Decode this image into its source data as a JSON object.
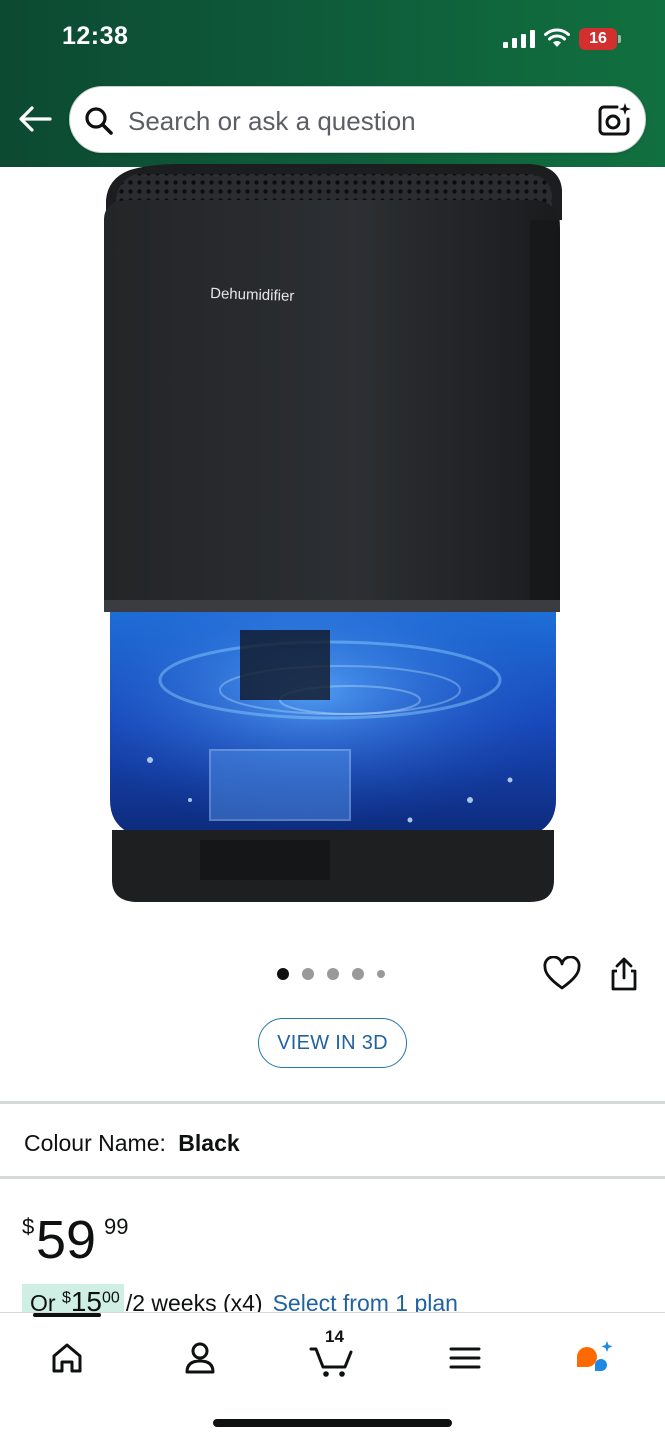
{
  "status_bar": {
    "time": "12:38",
    "battery_level": "16",
    "battery_color": "#d32f2f",
    "icons": [
      "cellular-signal-icon",
      "wifi-icon",
      "battery-icon"
    ]
  },
  "header": {
    "background_color": "#0e5a3a",
    "back_icon": "arrow-left-icon",
    "search": {
      "placeholder": "Search or ask a question",
      "value": "",
      "icon": "search-icon",
      "lens_icon": "camera-lens-icon"
    }
  },
  "product": {
    "image_label": "Dehumidifier",
    "image_count": 5,
    "active_image_index": 0,
    "wishlist_icon": "heart-icon",
    "share_icon": "share-icon",
    "view_3d_label": "VIEW IN 3D",
    "colour_label": "Colour Name:",
    "colour_value": "Black",
    "price": {
      "symbol": "$",
      "whole": "59",
      "fraction": "99"
    },
    "installment": {
      "prefix": "Or ",
      "symbol": "$",
      "whole": "15",
      "fraction": "00",
      "period": "/2 weeks (x4)",
      "link": "Select from 1 plan"
    }
  },
  "bottom_nav": {
    "items": [
      {
        "name": "home",
        "icon": "home-icon",
        "active": true
      },
      {
        "name": "account",
        "icon": "person-icon"
      },
      {
        "name": "cart",
        "icon": "cart-icon",
        "badge": "14"
      },
      {
        "name": "menu",
        "icon": "hamburger-menu-icon"
      },
      {
        "name": "rufus",
        "icon": "rufus-assistant-icon"
      }
    ],
    "accent_color": "#ff6a00"
  }
}
